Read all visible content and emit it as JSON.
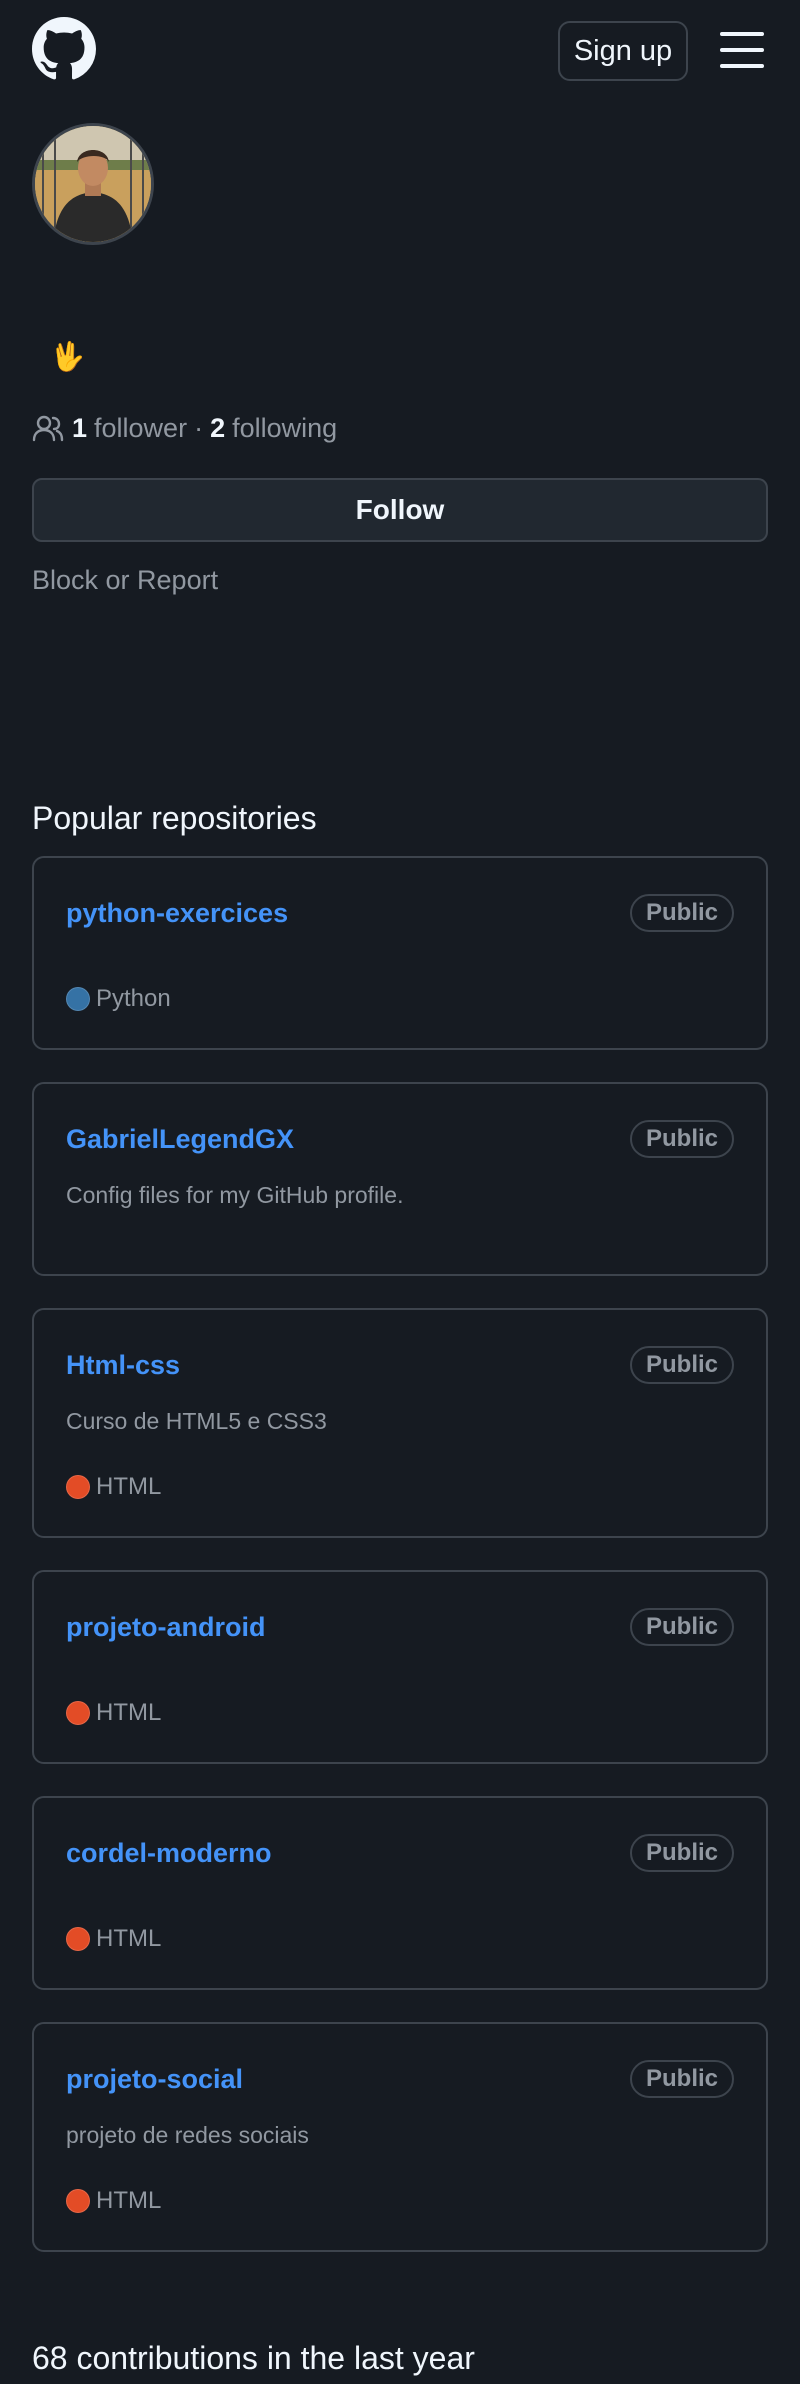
{
  "header": {
    "logo_icon": "github-mark-icon",
    "signup_label": "Sign up",
    "menu_icon": "hamburger-menu-icon"
  },
  "profile": {
    "avatar_alt": "avatar",
    "status_emoji": "🖖",
    "followers_count": "1",
    "followers_label": "follower",
    "separator": "·",
    "following_count": "2",
    "following_label": "following",
    "follow_label": "Follow",
    "block_label": "Block or Report"
  },
  "popular": {
    "title": "Popular repositories",
    "repos": [
      {
        "name": "python-exercices",
        "badge": "Public",
        "description": "",
        "language": "Python",
        "lang_color": "#3572A5"
      },
      {
        "name": "GabrielLegendGX",
        "badge": "Public",
        "description": "Config files for my GitHub profile.",
        "language": "",
        "lang_color": ""
      },
      {
        "name": "Html-css",
        "badge": "Public",
        "description": "Curso de HTML5 e CSS3",
        "language": "HTML",
        "lang_color": "#e34c26"
      },
      {
        "name": "projeto-android",
        "badge": "Public",
        "description": "",
        "language": "HTML",
        "lang_color": "#e34c26"
      },
      {
        "name": "cordel-moderno",
        "badge": "Public",
        "description": "",
        "language": "HTML",
        "lang_color": "#e34c26"
      },
      {
        "name": "projeto-social",
        "badge": "Public",
        "description": "projeto de redes sociais",
        "language": "HTML",
        "lang_color": "#e34c26"
      }
    ]
  },
  "contributions": {
    "title": "68 contributions in the last year"
  },
  "colors": {
    "background": "#161b22",
    "link": "#4493f8",
    "border": "#3d444d",
    "muted_text": "#9198a1",
    "bright_text": "#f0f6fc"
  }
}
